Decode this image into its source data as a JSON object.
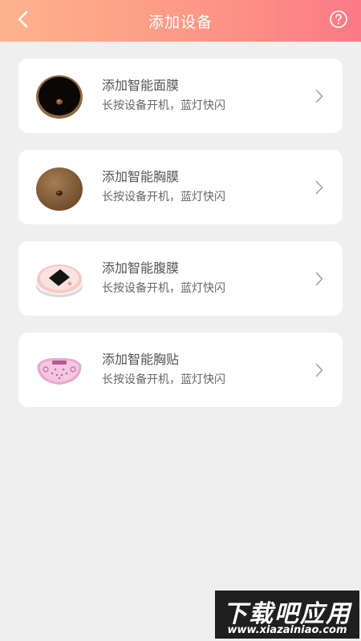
{
  "header": {
    "title": "添加设备"
  },
  "colors": {
    "header_gradient_start": "#fdb38c",
    "header_gradient_end": "#fc7a86",
    "background": "#efefef",
    "card": "#ffffff"
  },
  "devices": [
    {
      "name": "添加智能面膜",
      "hint": "长按设备开机，蓝灯快闪",
      "icon": "face-mask-device-icon"
    },
    {
      "name": "添加智能胸膜",
      "hint": "长按设备开机，蓝灯快闪",
      "icon": "chest-mask-device-icon"
    },
    {
      "name": "添加智能腹膜",
      "hint": "长按设备开机，蓝灯快闪",
      "icon": "abdomen-mask-device-icon"
    },
    {
      "name": "添加智能胸贴",
      "hint": "长按设备开机，蓝灯快闪",
      "icon": "chest-patch-device-icon"
    }
  ],
  "watermark": {
    "title": "下载吧应用",
    "url": "www.xiazainiao.com"
  }
}
